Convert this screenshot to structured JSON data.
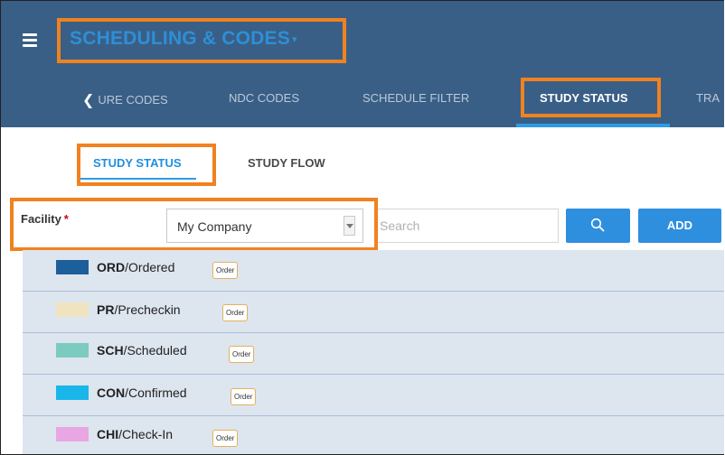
{
  "header": {
    "title": "SCHEDULING & CODES",
    "title_caret": "▾"
  },
  "nav": {
    "back_icon": "chevron-left-icon",
    "tabs": [
      {
        "label": "URE CODES"
      },
      {
        "label": "NDC CODES"
      },
      {
        "label": "SCHEDULE FILTER"
      },
      {
        "label": "STUDY STATUS",
        "active": true
      },
      {
        "label": "TRA"
      }
    ]
  },
  "subtabs": [
    {
      "label": "STUDY STATUS",
      "active": true
    },
    {
      "label": "STUDY FLOW"
    }
  ],
  "filter": {
    "facility_label": "Facility",
    "required_mark": "*",
    "facility_value": "My Company",
    "search_placeholder": "Search",
    "search_icon": "search-icon",
    "add_label": "ADD"
  },
  "statuses": [
    {
      "code": "ORD",
      "name": "/Ordered",
      "color": "#1d5f9a",
      "order_label": "Order"
    },
    {
      "code": "PR",
      "name": "/Precheckin",
      "color": "#efe4bf",
      "order_label": "Order"
    },
    {
      "code": "SCH",
      "name": "/Scheduled",
      "color": "#7ccbc0",
      "order_label": "Order"
    },
    {
      "code": "CON",
      "name": "/Confirmed",
      "color": "#19b6ea",
      "order_label": "Order"
    },
    {
      "code": "CHI",
      "name": "/Check-In",
      "color": "#e8a6e3",
      "order_label": "Order"
    }
  ],
  "colors": {
    "header_bg": "#3a5f86",
    "accent": "#2e8fdf",
    "highlight": "#f08220",
    "list_bg": "#dde5ef"
  }
}
